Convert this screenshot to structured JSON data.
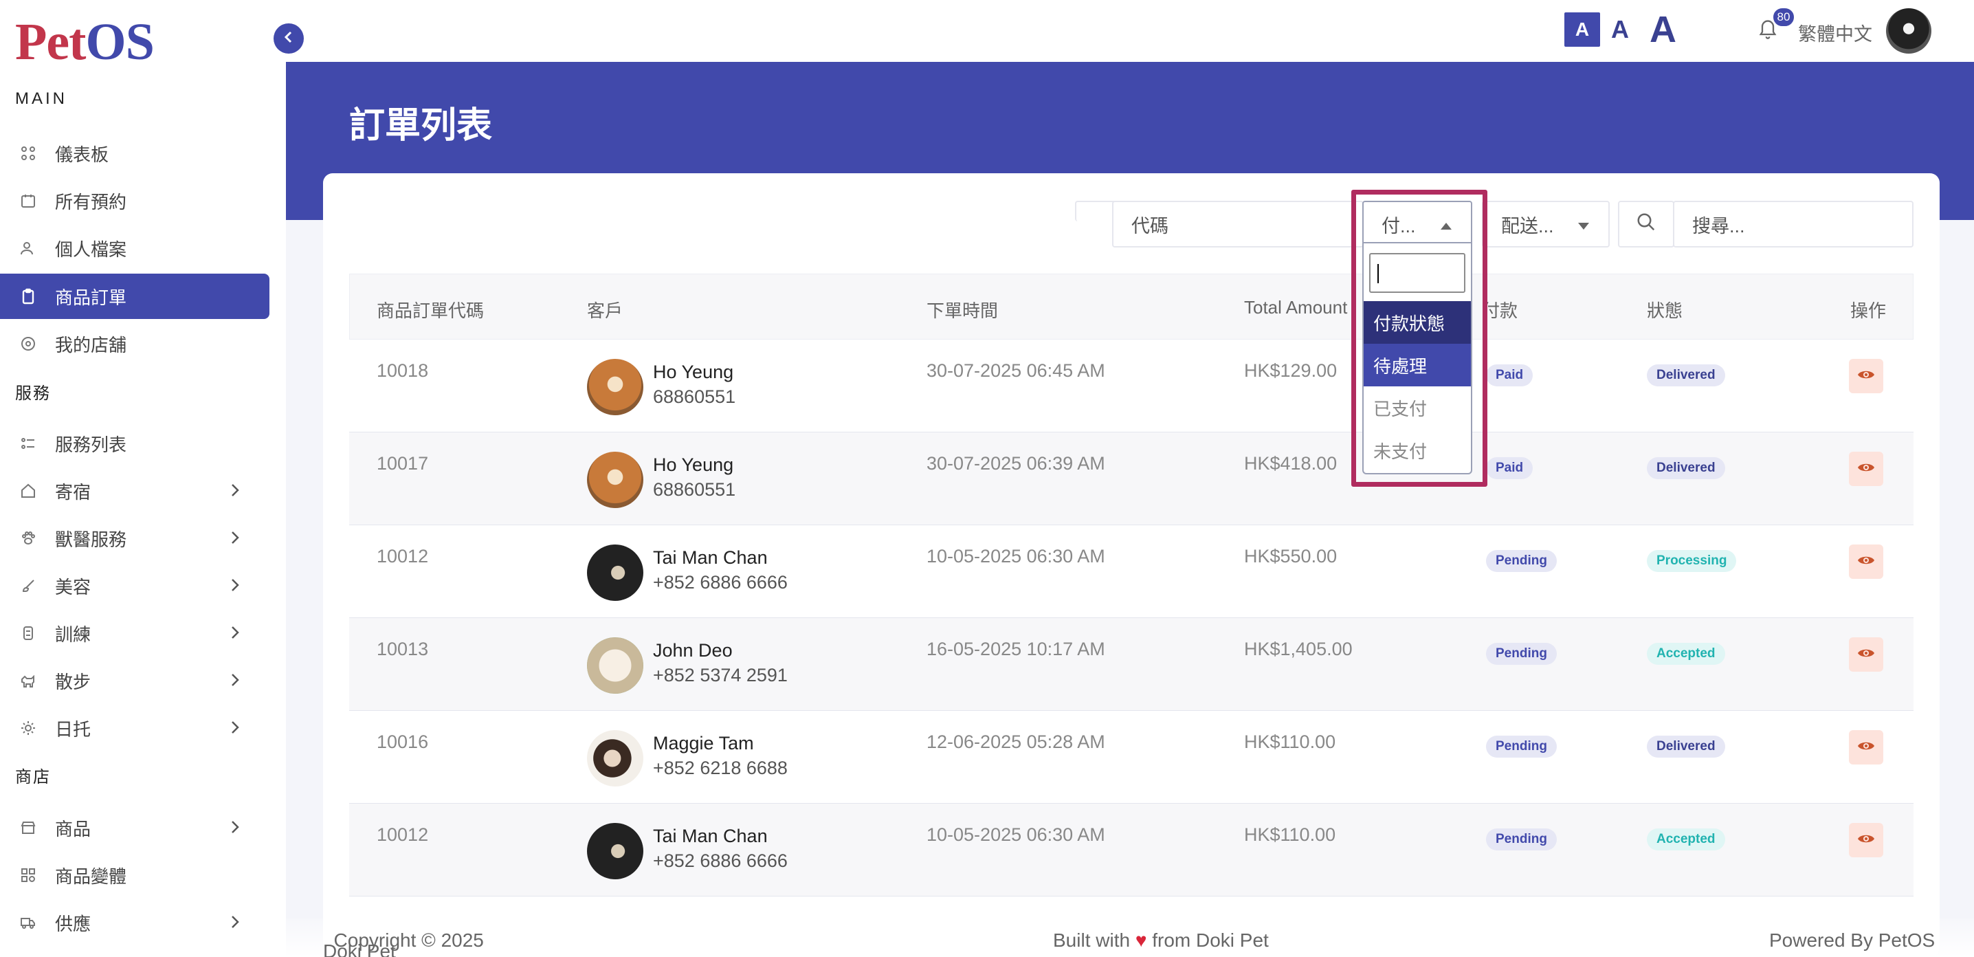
{
  "brand": {
    "logo_part1": "Pet",
    "logo_part2": "OS"
  },
  "sidebar": {
    "section_main": "MAIN",
    "section_services": "服務",
    "section_shop": "商店",
    "main_items": [
      {
        "label": "儀表板",
        "icon": "grid-icon"
      },
      {
        "label": "所有預約",
        "icon": "calendar-icon"
      },
      {
        "label": "個人檔案",
        "icon": "user-icon"
      },
      {
        "label": "商品訂單",
        "icon": "clipboard-icon",
        "active": true
      },
      {
        "label": "我的店舖",
        "icon": "store-icon"
      }
    ],
    "service_items": [
      {
        "label": "服務列表",
        "icon": "list-icon"
      },
      {
        "label": "寄宿",
        "icon": "house-icon"
      },
      {
        "label": "獸醫服務",
        "icon": "paw-icon"
      },
      {
        "label": "美容",
        "icon": "brush-icon"
      },
      {
        "label": "訓練",
        "icon": "bowl-icon"
      },
      {
        "label": "散步",
        "icon": "dog-icon"
      },
      {
        "label": "日托",
        "icon": "sun-icon"
      }
    ],
    "shop_items": [
      {
        "label": "商品",
        "icon": "shop-icon"
      },
      {
        "label": "商品變體",
        "icon": "variant-icon"
      },
      {
        "label": "供應",
        "icon": "truck-icon"
      }
    ]
  },
  "topbar": {
    "font_small": "A",
    "font_medium": "A",
    "font_large": "A",
    "notification_count": "80",
    "language": "繁體中文"
  },
  "page": {
    "title": "訂單列表"
  },
  "filters": {
    "code_placeholder": "代碼",
    "payment_label": "付...",
    "delivery_label": "配送...",
    "search_placeholder": "搜尋..."
  },
  "payment_dropdown": {
    "options": [
      "付款狀態",
      "待處理",
      "已支付",
      "未支付"
    ]
  },
  "table": {
    "headers": {
      "code": "商品訂單代碼",
      "customer": "客戶",
      "time": "下單時間",
      "amount": "Total Amount",
      "payment": "付款",
      "status": "狀態",
      "actions": "操作"
    },
    "rows": [
      {
        "code": "10018",
        "name": "Ho Yeung",
        "phone": "68860551",
        "time": "30-07-2025 06:45 AM",
        "amount": "HK$129.00",
        "payment": "Paid",
        "status": "Delivered"
      },
      {
        "code": "10017",
        "name": "Ho Yeung",
        "phone": "68860551",
        "time": "30-07-2025 06:39 AM",
        "amount": "HK$418.00",
        "payment": "Paid",
        "status": "Delivered"
      },
      {
        "code": "10012",
        "name": "Tai Man Chan",
        "phone": "+852 6886 6666",
        "time": "10-05-2025 06:30 AM",
        "amount": "HK$550.00",
        "payment": "Pending",
        "status": "Processing"
      },
      {
        "code": "10013",
        "name": "John Deo",
        "phone": "+852 5374 2591",
        "time": "16-05-2025 10:17 AM",
        "amount": "HK$1,405.00",
        "payment": "Pending",
        "status": "Accepted"
      },
      {
        "code": "10016",
        "name": "Maggie Tam",
        "phone": "+852 6218 6688",
        "time": "12-06-2025 05:28 AM",
        "amount": "HK$110.00",
        "payment": "Pending",
        "status": "Delivered"
      },
      {
        "code": "10012",
        "name": "Tai Man Chan",
        "phone": "+852 6886 6666",
        "time": "10-05-2025 06:30 AM",
        "amount": "HK$110.00",
        "payment": "Pending",
        "status": "Accepted"
      }
    ]
  },
  "footer": {
    "brand_link": "Doki Pet",
    "copyright": ". Copyright © 2025",
    "built_with_prefix": "Built with",
    "heart": "♥",
    "built_with_suffix": "from Doki Pet",
    "powered_prefix": "Powered By",
    "powered_link": "PetOS"
  },
  "colors": {
    "primary": "#4149ab",
    "highlight": "#b02c5f",
    "accent_teal": "#21b3b0",
    "eye_bg": "#fde3dc"
  }
}
